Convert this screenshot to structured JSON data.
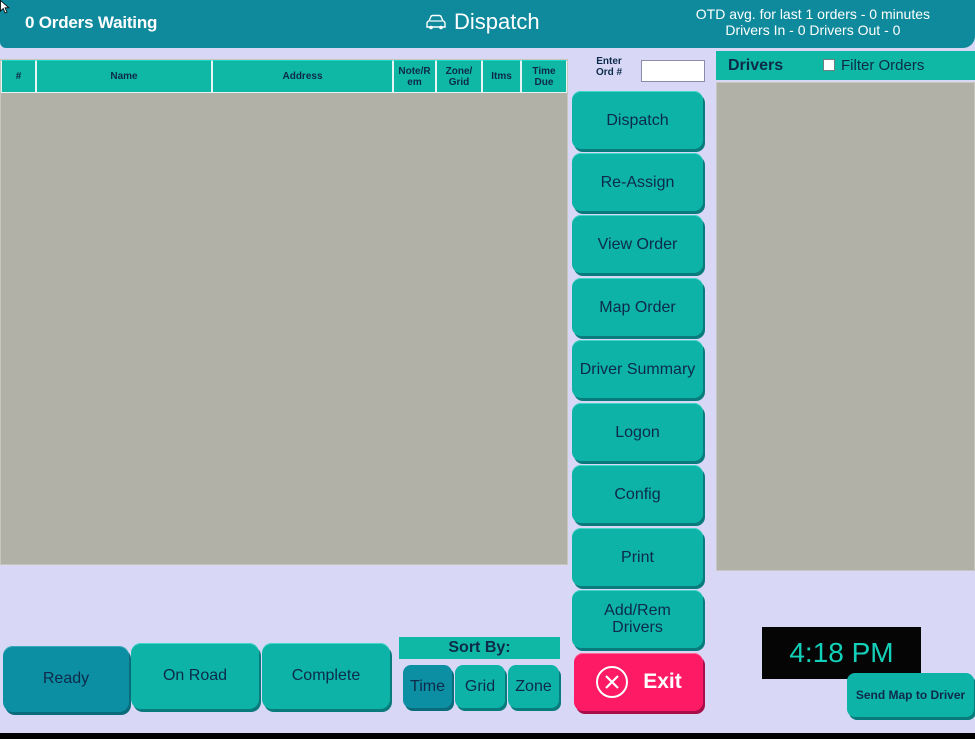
{
  "header": {
    "orders_waiting": "0 Orders Waiting",
    "title": "Dispatch",
    "title_icon": "car-icon",
    "otd_line1": "OTD avg. for last 1 orders - 0 minutes",
    "otd_line2": "Drivers In - 0   Drivers Out - 0"
  },
  "orders_table": {
    "columns": [
      "#",
      "Name",
      "Address",
      "Note/R em",
      "Zone/ Grid",
      "Itms",
      "Time Due"
    ],
    "rows": []
  },
  "enter_order": {
    "label": "Enter Ord #",
    "value": ""
  },
  "side_buttons": [
    "Dispatch",
    "Re-Assign",
    "View Order",
    "Map Order",
    "Driver Summary",
    "Logon",
    "Config",
    "Print",
    "Add/Rem Drivers"
  ],
  "exit_button": {
    "label": "Exit",
    "icon": "close-circle-icon"
  },
  "drivers": {
    "title": "Drivers",
    "filter_label": "Filter Orders",
    "filter_checked": false
  },
  "bottom_buttons": {
    "ready": "Ready",
    "on_road": "On Road",
    "complete": "Complete"
  },
  "sort": {
    "label": "Sort By:",
    "options": [
      "Time",
      "Grid",
      "Zone"
    ],
    "selected": "Time"
  },
  "clock": "4:18 PM",
  "send_map_button": "Send Map to Driver",
  "colors": {
    "header": "#0f8a9c",
    "button": "#0db3a6",
    "button_active": "#0c8fa2",
    "exit": "#ff1a66",
    "panel": "#b1b1a8",
    "background": "#d8d8f6"
  }
}
